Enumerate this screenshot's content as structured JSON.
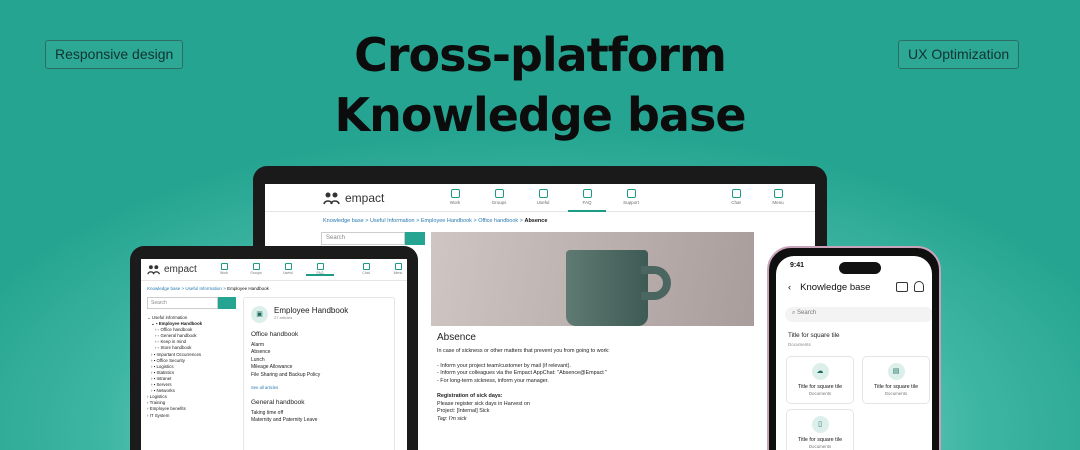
{
  "badges": {
    "left": "Responsive design",
    "right": "UX Optimization"
  },
  "title": {
    "line1": "Cross-platform",
    "line2": "Knowledge base"
  },
  "brand": "empact",
  "laptop": {
    "nav": [
      "Work",
      "Groups",
      "Useful",
      "FAQ",
      "Support"
    ],
    "nav_right": [
      "Chat",
      "Menu"
    ],
    "breadcrumb": [
      "Knowledge base",
      "Useful Information",
      "Employee Handbook",
      "Office handbook",
      "Absence"
    ],
    "search_placeholder": "Search",
    "article_title": "Absence",
    "article_lines": [
      "In case of sickness or other matters that prevent you from going to work:",
      "",
      "- Inform your project team/customer by mail (if relevant).",
      "- Inform your colleagues via the Empact AppChat: \"Absence@Empact \"",
      "- For long-term sickness, inform your manager.",
      "",
      "Registration of sick days:",
      "Please register sick days in Harvest on",
      "Project: [Internal] Sick",
      "Tag: I'm sick"
    ]
  },
  "tablet": {
    "nav": [
      "Work",
      "Groups",
      "Useful",
      "FAQ"
    ],
    "nav_right": [
      "Chat",
      "Menu"
    ],
    "breadcrumb": [
      "Knowledge base",
      "Useful Information",
      "Employee Handbook"
    ],
    "search_placeholder": "Search",
    "tree": [
      "Useful information",
      "Employee Handbook",
      "Office handbook",
      "General handbook",
      "Keep in mind",
      "Store handbook",
      "Important Occurrences",
      "Office Security",
      "Logistics",
      "Statistics",
      "Intranet",
      "Servers",
      "Networks",
      "Logistics",
      "Training",
      "Employee benefits",
      "IT System"
    ],
    "card_title": "Employee Handbook",
    "card_sub": "27 articles",
    "section1": "Office handbook",
    "section1_items": [
      "Alarm",
      "Absence",
      "Lunch",
      "Mileage Allowance",
      "File Sharing and Backup Policy"
    ],
    "see_all": "See all articles",
    "section2": "General handbook",
    "section2_items": [
      "Taking time off",
      "Maternity and Paternity Leave"
    ]
  },
  "phone": {
    "time": "9:41",
    "title": "Knowledge base",
    "search_placeholder": "Search",
    "section_title": "Title for square tile",
    "section_sub": "Documents",
    "tiles": [
      {
        "title": "Title for square tile",
        "sub": "Documents"
      },
      {
        "title": "Title for square tile",
        "sub": "Documents"
      },
      {
        "title": "Title for square tile",
        "sub": "Documents"
      }
    ]
  }
}
